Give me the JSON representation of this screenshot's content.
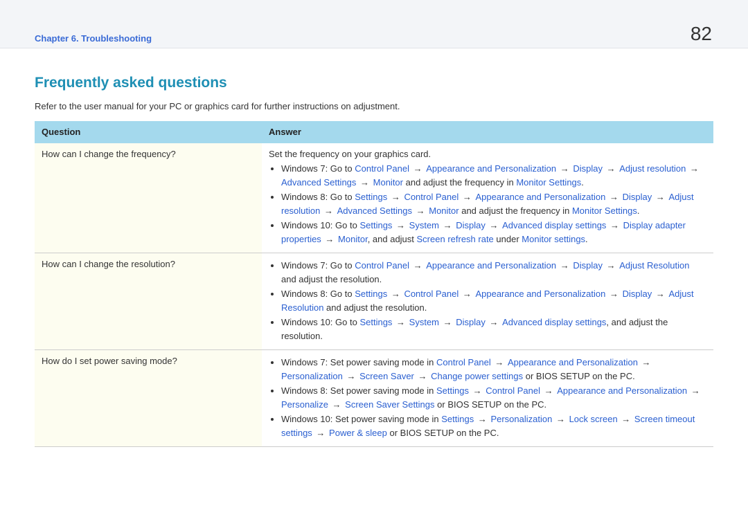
{
  "header": {
    "chapter": "Chapter 6. Troubleshooting",
    "page_number": "82"
  },
  "section": {
    "title": "Frequently asked questions",
    "intro": "Refer to the user manual for your PC or graphics card for further instructions on adjustment."
  },
  "table": {
    "headers": {
      "question": "Question",
      "answer": "Answer"
    },
    "rows": [
      {
        "question": "How can I change the frequency?",
        "answer_lead": "Set the frequency on your graphics card.",
        "bullets": [
          {
            "prefix": "Windows 7: Go to ",
            "path": [
              "Control Panel",
              "Appearance and Personalization",
              "Display",
              "Adjust resolution",
              "Advanced Settings",
              "Monitor"
            ],
            "tail_plain": " and adjust the frequency in ",
            "tail_links": [
              "Monitor Settings"
            ],
            "tail_after": "."
          },
          {
            "prefix": "Windows 8: Go to ",
            "path": [
              "Settings",
              "Control Panel",
              "Appearance and Personalization",
              "Display",
              "Adjust resolution",
              "Advanced Settings",
              "Monitor"
            ],
            "tail_plain": " and adjust the frequency in ",
            "tail_links": [
              "Monitor Settings"
            ],
            "tail_after": "."
          },
          {
            "prefix": "Windows 10: Go to ",
            "path": [
              "Settings",
              "System",
              "Display",
              "Advanced display settings",
              "Display adapter properties",
              "Monitor"
            ],
            "tail_plain": ", and adjust ",
            "tail_links": [
              "Screen refresh rate"
            ],
            "tail_mid": " under ",
            "tail_links2": [
              "Monitor settings"
            ],
            "tail_after": "."
          }
        ]
      },
      {
        "question": "How can I change the resolution?",
        "bullets": [
          {
            "prefix": "Windows 7: Go to ",
            "path": [
              "Control Panel",
              "Appearance and Personalization",
              "Display",
              "Adjust Resolution"
            ],
            "tail_plain": " and adjust the resolution.",
            "tail_after": ""
          },
          {
            "prefix": "Windows 8: Go to ",
            "path": [
              "Settings",
              "Control Panel",
              "Appearance and Personalization",
              "Display",
              "Adjust Resolution"
            ],
            "tail_plain": " and adjust the resolution.",
            "tail_after": ""
          },
          {
            "prefix": "Windows 10: Go to ",
            "path": [
              "Settings",
              "System",
              "Display",
              "Advanced display settings"
            ],
            "tail_plain": ", and adjust the resolution.",
            "tail_after": ""
          }
        ]
      },
      {
        "question": "How do I set power saving mode?",
        "bullets": [
          {
            "prefix": "Windows 7: Set power saving mode in ",
            "path": [
              "Control Panel",
              "Appearance and Personalization",
              "Personalization",
              "Screen Saver",
              "Change power settings"
            ],
            "tail_plain": " or BIOS SETUP on the PC.",
            "tail_after": ""
          },
          {
            "prefix": "Windows 8: Set power saving mode in ",
            "path": [
              "Settings",
              "Control Panel",
              "Appearance and Personalization",
              "Personalize",
              "Screen Saver Settings"
            ],
            "tail_plain": " or BIOS SETUP on the PC.",
            "tail_after": ""
          },
          {
            "prefix": "Windows 10: Set power saving mode in ",
            "path": [
              "Settings",
              "Personalization",
              "Lock screen",
              "Screen timeout settings",
              "Power & sleep"
            ],
            "tail_plain": " or BIOS SETUP on the PC.",
            "tail_after": ""
          }
        ]
      }
    ]
  }
}
